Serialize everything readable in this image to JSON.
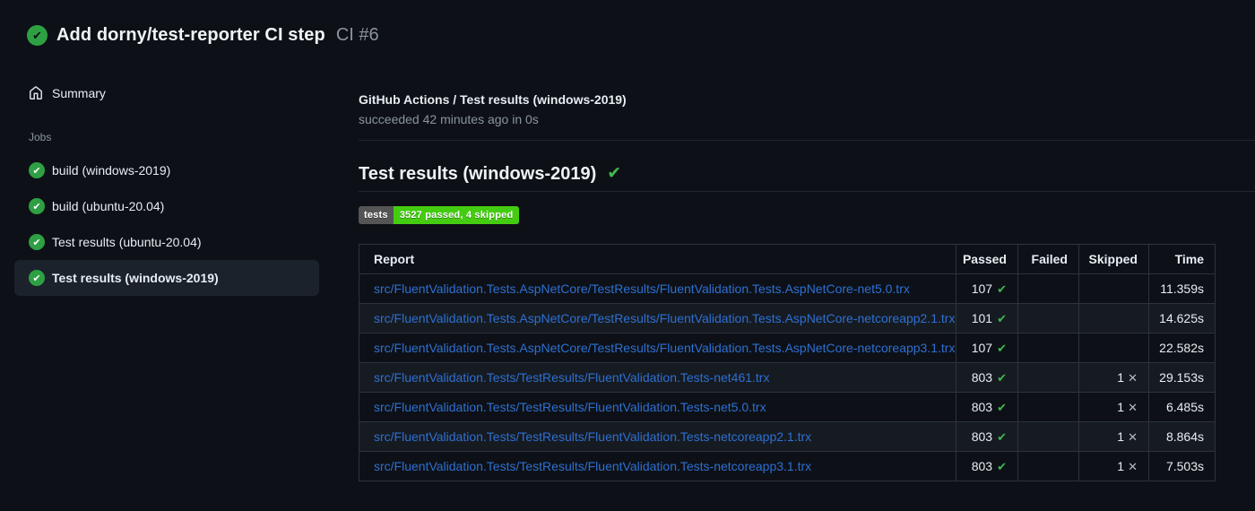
{
  "header": {
    "title": "Add dorny/test-reporter CI step",
    "run_number": "CI #6"
  },
  "sidebar": {
    "summary_label": "Summary",
    "jobs_label": "Jobs",
    "jobs": [
      {
        "label": "build (windows-2019)",
        "selected": false
      },
      {
        "label": "build (ubuntu-20.04)",
        "selected": false
      },
      {
        "label": "Test results (ubuntu-20.04)",
        "selected": false
      },
      {
        "label": "Test results (windows-2019)",
        "selected": true
      }
    ]
  },
  "main": {
    "check_title": "GitHub Actions / Test results (windows-2019)",
    "check_status": "succeeded 42 minutes ago in 0s",
    "report_heading": "Test results (windows-2019)",
    "badge": {
      "label": "tests",
      "value": "3527 passed, 4 skipped"
    },
    "table": {
      "headers": [
        "Report",
        "Passed",
        "Failed",
        "Skipped",
        "Time"
      ],
      "rows": [
        {
          "report": "src/FluentValidation.Tests.AspNetCore/TestResults/FluentValidation.Tests.AspNetCore-net5.0.trx",
          "passed": "107",
          "failed": "",
          "skipped": "",
          "time": "11.359s"
        },
        {
          "report": "src/FluentValidation.Tests.AspNetCore/TestResults/FluentValidation.Tests.AspNetCore-netcoreapp2.1.trx",
          "passed": "101",
          "failed": "",
          "skipped": "",
          "time": "14.625s"
        },
        {
          "report": "src/FluentValidation.Tests.AspNetCore/TestResults/FluentValidation.Tests.AspNetCore-netcoreapp3.1.trx",
          "passed": "107",
          "failed": "",
          "skipped": "",
          "time": "22.582s"
        },
        {
          "report": "src/FluentValidation.Tests/TestResults/FluentValidation.Tests-net461.trx",
          "passed": "803",
          "failed": "",
          "skipped": "1",
          "time": "29.153s"
        },
        {
          "report": "src/FluentValidation.Tests/TestResults/FluentValidation.Tests-net5.0.trx",
          "passed": "803",
          "failed": "",
          "skipped": "1",
          "time": "6.485s"
        },
        {
          "report": "src/FluentValidation.Tests/TestResults/FluentValidation.Tests-netcoreapp2.1.trx",
          "passed": "803",
          "failed": "",
          "skipped": "1",
          "time": "8.864s"
        },
        {
          "report": "src/FluentValidation.Tests/TestResults/FluentValidation.Tests-netcoreapp3.1.trx",
          "passed": "803",
          "failed": "",
          "skipped": "1",
          "time": "7.503s"
        }
      ]
    }
  },
  "icons": {
    "check": "✔",
    "cross": "✕",
    "home": "home-icon"
  },
  "colors": {
    "page_bg": "#0d1117",
    "circle_green": "#2ea043",
    "check_green": "#3fb950",
    "link_blue": "#2e6fd2",
    "badge_label_bg": "#555555",
    "badge_value_bg": "#44cc11"
  }
}
